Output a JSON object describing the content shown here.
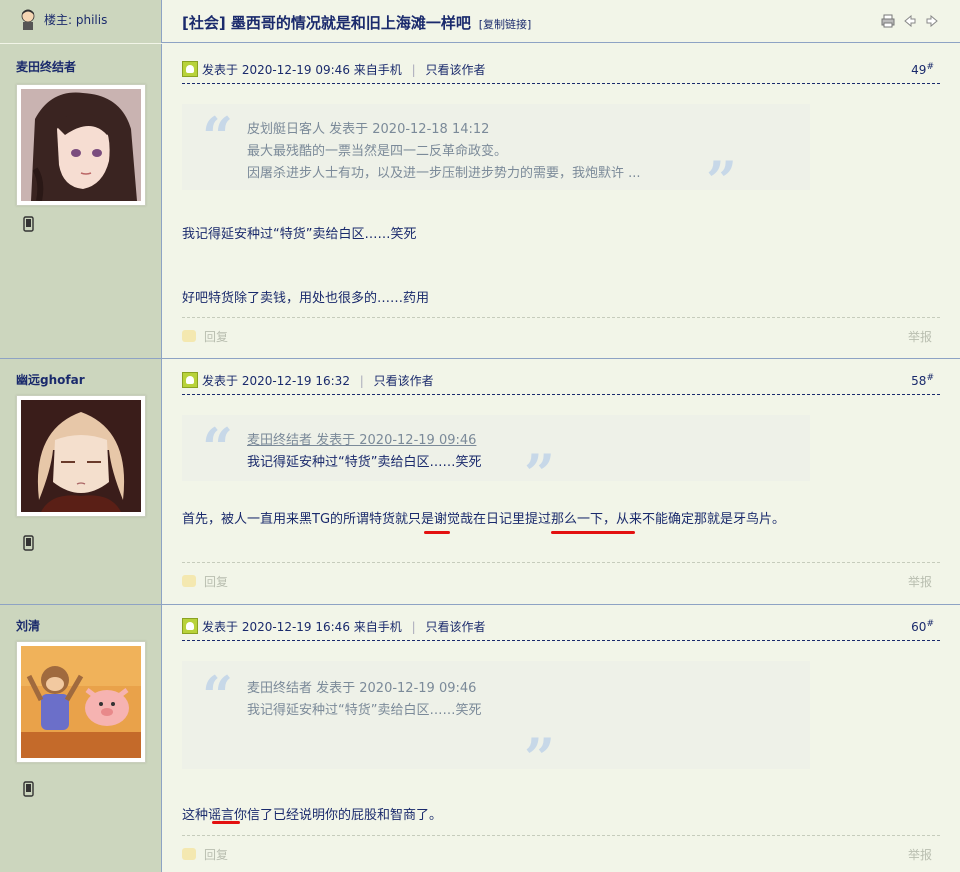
{
  "thread": {
    "op_label": "楼主: philis",
    "title": "[社会] 墨西哥的情况就是和旧上海滩一样吧",
    "copy_link": "[复制链接]",
    "tools": [
      "print-icon",
      "arrow-left-icon",
      "arrow-right-icon"
    ]
  },
  "posts": [
    {
      "author": "麦田终结者",
      "posted": "发表于 2020-12-19 09:46 来自手机",
      "only_author": "只看该作者",
      "floor": "49",
      "floor_sup": "#",
      "quote": {
        "header": "皮划艇日客人 发表于 2020-12-18 14:12",
        "lines": [
          "最大最残酷的一票当然是四一二反革命政变。",
          "因屠杀进步人士有功，以及进一步压制进步势力的需要，我炮默许 ..."
        ]
      },
      "body": [
        "我记得延安种过“特货”卖给白区……笑死",
        "好吧特货除了卖钱，用处也很多的……药用"
      ],
      "reply": "回复",
      "report": "举报"
    },
    {
      "author": "幽远ghofar",
      "posted": "发表于 2020-12-19 16:32",
      "only_author": "只看该作者",
      "floor": "58",
      "floor_sup": "#",
      "quote": {
        "header": "麦田终结者 发表于 2020-12-19 09:46",
        "lines": [
          "我记得延安种过“特货”卖给白区……笑死"
        ]
      },
      "body": [
        "首先，被人一直用来黑TG的所谓特货就只是谢觉哉在日记里提过那么一下，从来不能确定那就是牙鸟片。"
      ],
      "reply": "回复",
      "report": "举报"
    },
    {
      "author": "刘清",
      "posted": "发表于 2020-12-19 16:46 来自手机",
      "only_author": "只看该作者",
      "floor": "60",
      "floor_sup": "#",
      "quote": {
        "header": "麦田终结者 发表于 2020-12-19 09:46",
        "lines": [
          "我记得延安种过“特货”卖给白区……笑死"
        ]
      },
      "body": [
        "这种谣言你信了已经说明你的屁股和智商了。"
      ],
      "reply": "回复",
      "report": "举报"
    }
  ],
  "colors": {
    "accent": "#1a2a6c",
    "sidebar": "#ccd6be",
    "content_bg": "#f2f5e8",
    "highlight_underline": "#e31010"
  }
}
